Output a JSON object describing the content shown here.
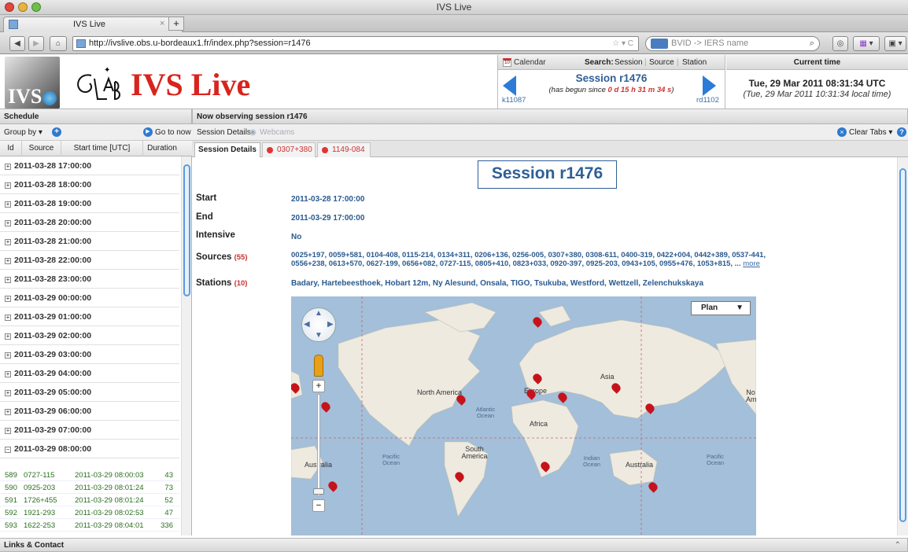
{
  "window": {
    "title": "IVS Live"
  },
  "browser": {
    "tab_title": "IVS Live",
    "url": "http://ivslive.obs.u-bordeaux1.fr/index.php?session=r1476",
    "search_engine_label": "BVID -> IERS name"
  },
  "header": {
    "logo_text": "IVS Live",
    "calendar_label": "Calendar",
    "search_label": "Search:",
    "search_links": [
      "Session",
      "Source",
      "Station"
    ],
    "current_time_label": "Current time",
    "session_title": "Session r1476",
    "session_since_prefix": "(has begun since ",
    "session_since_value": "0 d 15 h 31 m 34 s",
    "session_since_suffix": ")",
    "prev_session": "k11087",
    "next_session": "rd1102",
    "utc_time": "Tue, 29 Mar 2011 08:31:34 UTC",
    "local_time": "(Tue, 29 Mar 2011 10:31:34 local time)"
  },
  "schedule": {
    "title": "Schedule",
    "group_by": "Group by",
    "go_to_now": "Go to now",
    "columns": [
      "Id",
      "Source",
      "Start time [UTC]",
      "Duration"
    ],
    "groups": [
      "2011-03-28 17:00:00",
      "2011-03-28 18:00:00",
      "2011-03-28 19:00:00",
      "2011-03-28 20:00:00",
      "2011-03-28 21:00:00",
      "2011-03-28 22:00:00",
      "2011-03-28 23:00:00",
      "2011-03-29 00:00:00",
      "2011-03-29 01:00:00",
      "2011-03-29 02:00:00",
      "2011-03-29 03:00:00",
      "2011-03-29 04:00:00",
      "2011-03-29 05:00:00",
      "2011-03-29 06:00:00",
      "2011-03-29 07:00:00"
    ],
    "open_group": "2011-03-29 08:00:00",
    "plus": "+",
    "minus": "−",
    "observations": [
      {
        "id": "589",
        "source": "0727-115",
        "start": "2011-03-29 08:00:03",
        "duration": "43"
      },
      {
        "id": "590",
        "source": "0925-203",
        "start": "2011-03-29 08:01:24",
        "duration": "73"
      },
      {
        "id": "591",
        "source": "1726+455",
        "start": "2011-03-29 08:01:24",
        "duration": "52"
      },
      {
        "id": "592",
        "source": "1921-293",
        "start": "2011-03-29 08:02:53",
        "duration": "47"
      },
      {
        "id": "593",
        "source": "1622-253",
        "start": "2011-03-29 08:04:01",
        "duration": "336"
      }
    ]
  },
  "main": {
    "title": "Now observing session r1476",
    "session_details_link": "Session Details",
    "webcams_link": "Webcams",
    "clear_tabs": "Clear Tabs",
    "tabs": [
      "Session Details",
      "0307+380",
      "1149-084"
    ],
    "heading": "Session r1476",
    "start_label": "Start",
    "start_value": "2011-03-28 17:00:00",
    "end_label": "End",
    "end_value": "2011-03-29 17:00:00",
    "intensive_label": "Intensive",
    "intensive_value": "No",
    "sources_label": "Sources",
    "sources_count": "(55)",
    "sources_line1": "0025+197, 0059+581, 0104-408, 0115-214, 0134+311, 0206+136, 0256-005, 0307+380, 0308-611, 0400-319, 0422+004, 0442+389, 0537-441,",
    "sources_line2": "0556+238, 0613+570, 0627-199, 0656+082, 0727-115, 0805+410, 0823+033, 0920-397, 0925-203, 0943+105, 0955+476, 1053+815, ...",
    "more_link": "more",
    "stations_label": "Stations",
    "stations_count": "(10)",
    "stations_value": "Badary, Hartebeesthoek, Hobart 12m, Ny Alesund, Onsala, TIGO, Tsukuba, Westford, Wettzell, Zelenchukskaya"
  },
  "map": {
    "type_select": "Plan",
    "labels": {
      "north_america": "North America",
      "europe": "Europe",
      "asia": "Asia",
      "africa": "Africa",
      "south_america": "South America",
      "australia_left": "Australia",
      "australia_right": "Australia",
      "north_america_right": "No Am",
      "atlantic": "Atlantic Ocean",
      "pacific_left": "Pacific Ocean",
      "indian": "Indian Ocean",
      "pacific_right": "Pacific Ocean"
    },
    "colors": {
      "ocean": "#a3bfd9",
      "land": "#eeeae0"
    }
  },
  "footer": {
    "title": "Links & Contact"
  }
}
